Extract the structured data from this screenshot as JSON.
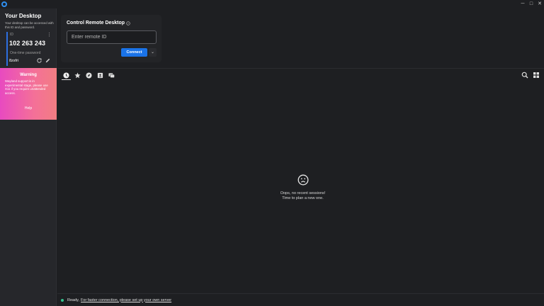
{
  "colors": {
    "accent": "#1a73e8",
    "id_bar": "#2d6fe0",
    "status_ok": "#34c38f",
    "warning_start": "#e84ac0",
    "warning_end": "#f27d82"
  },
  "window": {
    "controls": [
      "─",
      "□",
      "✕"
    ]
  },
  "sidebar": {
    "title": "Your Desktop",
    "description": "Your desktop can be accessed with this ID and password.",
    "id_label": "ID",
    "id_value": "102 263 243",
    "password_label": "One-time password",
    "password_value": "8zsfri",
    "icons": {
      "menu": "kebab-menu-icon",
      "refresh": "refresh-icon",
      "edit": "pencil-icon"
    }
  },
  "warning": {
    "title": "Warning",
    "text": "Wayland support is in experimental stage, please use X11 if you require unattended access.",
    "help": "Help"
  },
  "connect": {
    "title": "Control Remote Desktop",
    "input_placeholder": "Enter remote ID",
    "input_value": "",
    "connect_label": "Connect",
    "more_label": "⌄"
  },
  "tabs": [
    {
      "icon": "clock-icon",
      "selected": true
    },
    {
      "icon": "star-icon",
      "selected": false
    },
    {
      "icon": "compass-icon",
      "selected": false
    },
    {
      "icon": "address-book-icon",
      "selected": false
    },
    {
      "icon": "group-icon",
      "selected": false
    }
  ],
  "toolbar_icons": [
    "search-icon",
    "grid-view-icon"
  ],
  "empty_state": {
    "icon": "sad-face-icon",
    "line1": "Oops, no recent sessions!",
    "line2": "Time to plan a new one."
  },
  "status": {
    "ready": "Ready,",
    "link": "For faster connection, please set up your own server"
  }
}
